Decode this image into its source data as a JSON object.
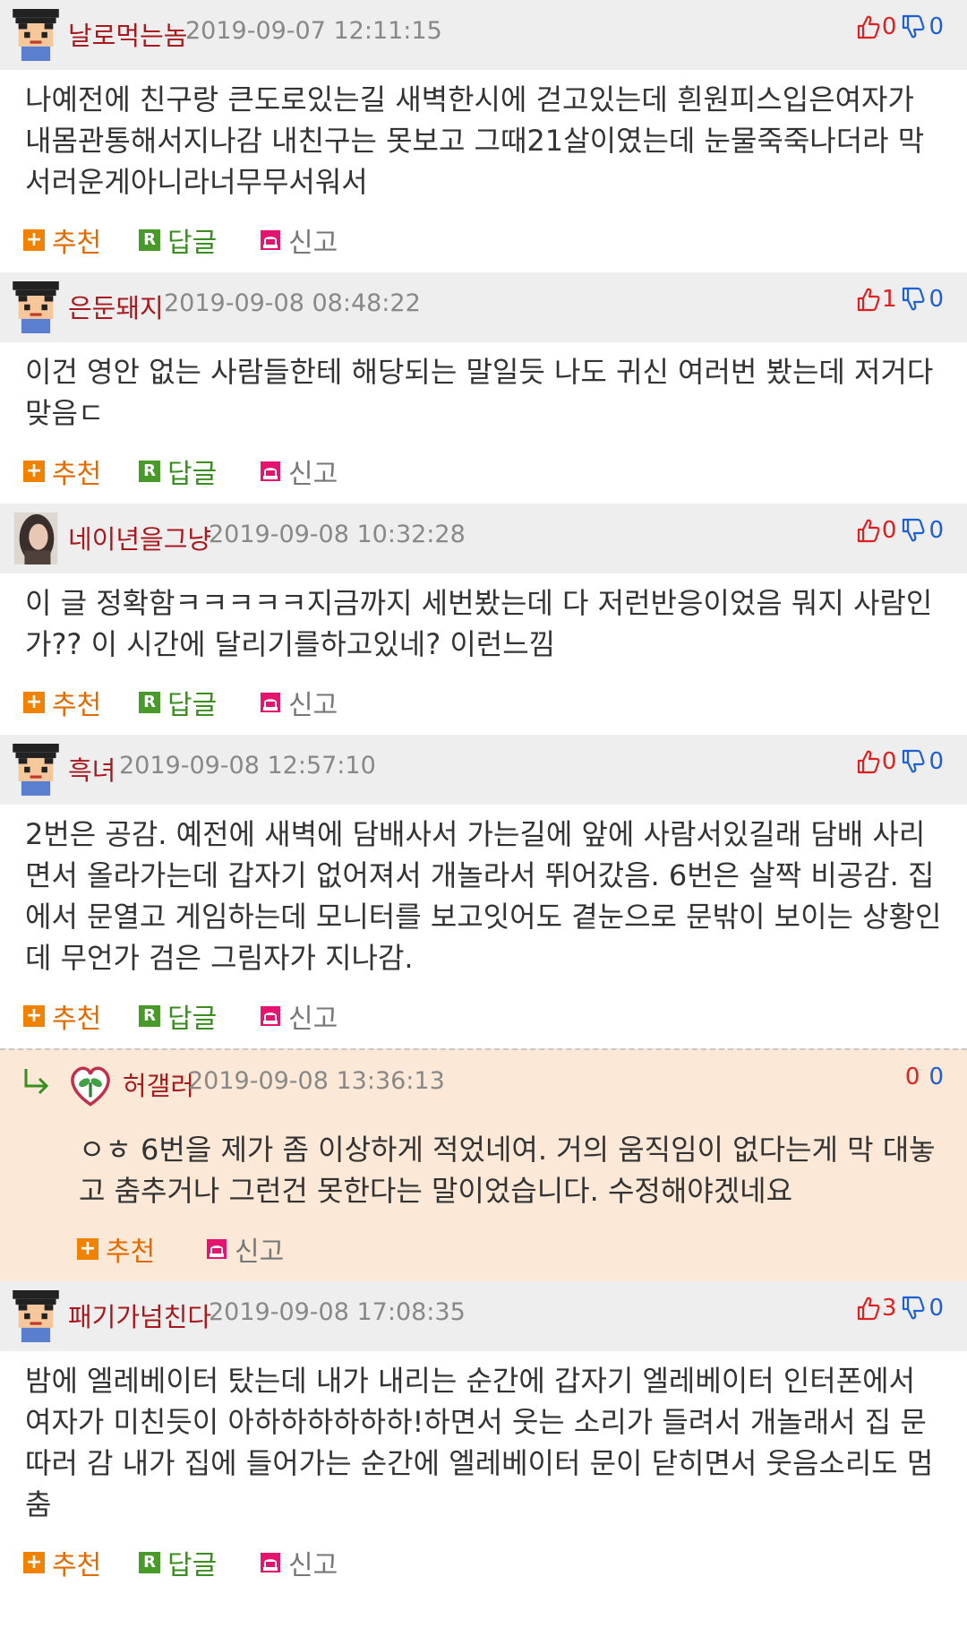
{
  "colors": {
    "nickname": "#a8191e",
    "date": "#888888",
    "header_bg": "#eeeeee",
    "reply_bg": "#fbe8d6",
    "upvote": "#e02020",
    "downvote": "#1f5fd6",
    "recommend": "#e26a00",
    "reply_link": "#3a8d1f",
    "report": "#777777"
  },
  "labels": {
    "recommend": "추천",
    "reply": "답글",
    "report": "신고",
    "r_icon": "R",
    "plus_icon": "+"
  },
  "comments": [
    {
      "nickname": "날로먹는놈",
      "date": "2019-09-07 12:11:15",
      "up": "0",
      "down": "0",
      "avatar": "pixel-avatar-icon",
      "text": "나예전에 친구랑 큰도로있는길 새벽한시에 걷고있는데 흰원피스입은여자가 내몸관통해서지나감 내친구는 못보고 그때21살이였는데 눈물죽죽나더라 막서러운게아니라너무무서워서"
    },
    {
      "nickname": "은둔돼지",
      "date": "2019-09-08 08:48:22",
      "up": "1",
      "down": "0",
      "avatar": "pixel-avatar-icon",
      "text": "이건 영안 없는 사람들한테 해당되는 말일듯 나도 귀신 여러번 봤는데 저거다 맞음ㄷ"
    },
    {
      "nickname": "네이년을그냥",
      "date": "2019-09-08 10:32:28",
      "up": "0",
      "down": "0",
      "avatar": "photo-avatar-icon",
      "text": "이 글 정확함ㅋㅋㅋㅋㅋ지금까지 세번봤는데 다 저런반응이었음 뭐지 사람인가?? 이 시간에 달리기를하고있네? 이런느낌"
    },
    {
      "nickname": "흑녀",
      "date": "2019-09-08 12:57:10",
      "up": "0",
      "down": "0",
      "avatar": "pixel-avatar-icon",
      "text": "2번은 공감. 예전에 새벽에 담배사서 가는길에 앞에 사람서있길래 담배 사리면서 올라가는데 갑자기 없어져서 개놀라서 뛰어갔음. 6번은 살짝 비공감. 집에서 문열고 게임하는데 모니터를 보고잇어도 곁눈으로 문밖이 보이는 상황인데 무언가 검은 그림자가 지나감."
    },
    {
      "nickname": "허갤러",
      "date": "2019-09-08 13:36:13",
      "up": "0",
      "down": "0",
      "avatar": "heart-leaf-avatar-icon",
      "is_reply": true,
      "text": "ㅇㅎ 6번을 제가 좀 이상하게 적었네여. 거의 움직임이 없다는게 막 대놓고 춤추거나 그런건 못한다는 말이었습니다. 수정해야겠네요"
    },
    {
      "nickname": "패기가넘친다",
      "date": "2019-09-08 17:08:35",
      "up": "3",
      "down": "0",
      "avatar": "pixel-avatar-icon",
      "text": "밤에 엘레베이터 탔는데 내가 내리는 순간에 갑자기 엘레베이터 인터폰에서 여자가 미친듯이 아하하하하하하!하면서 웃는 소리가 들려서 개놀래서 집 문따러 감 내가 집에 들어가는 순간에 엘레베이터 문이 닫히면서 웃음소리도 멈춤"
    }
  ]
}
